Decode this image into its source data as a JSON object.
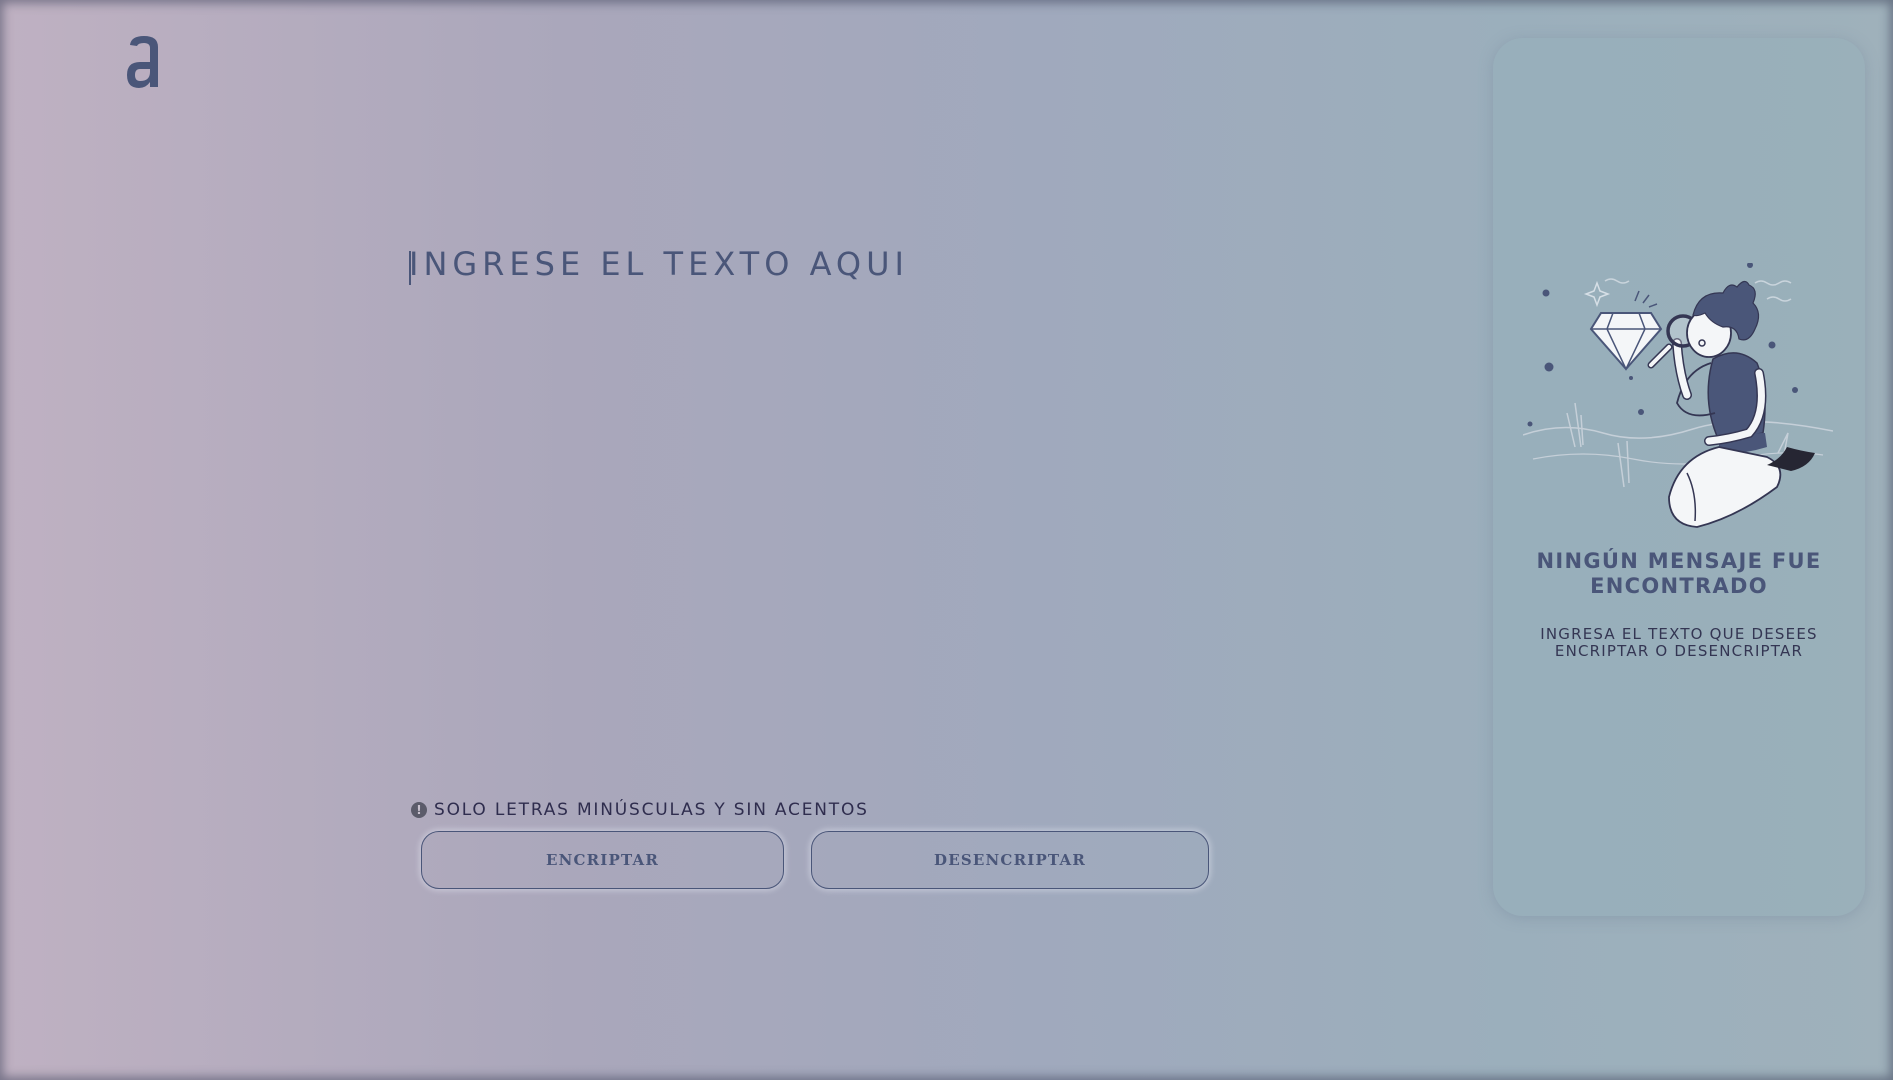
{
  "header": {
    "logo_icon": "alura-logo-icon"
  },
  "editor": {
    "placeholder": "INGRESE EL TEXTO AQUI",
    "value": ""
  },
  "info": {
    "icon": "exclamation-circle-icon",
    "text": "SOLO LETRAS MINÚSCULAS Y SIN ACENTOS"
  },
  "buttons": {
    "encrypt_label": "ENCRIPTAR",
    "decrypt_label": "DESENCRIPTAR"
  },
  "output_panel": {
    "illustration_icon": "person-with-magnifying-glass-illustration",
    "title": "NINGÚN MENSAJE FUE ENCONTRADO",
    "subtitle": "INGRESA EL TEXTO QUE DESEES ENCRIPTAR O DESENCRIPTAR"
  },
  "colors": {
    "accent": "#4a5679",
    "dark_text": "#343653",
    "background_left": "#bfb1c2",
    "background_right": "#9fb1bb"
  }
}
